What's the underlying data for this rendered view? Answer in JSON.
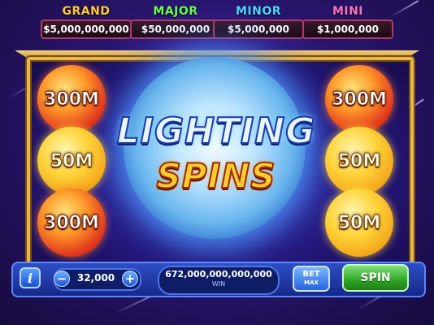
{
  "jackpots": [
    {
      "label": "GRAND",
      "value": "$5,000,000,000",
      "color": "#ffcc33"
    },
    {
      "label": "MAJOR",
      "value": "$50,000,000",
      "color": "#6bff4a"
    },
    {
      "label": "MINOR",
      "value": "$5,000,000",
      "color": "#4ad8ff"
    },
    {
      "label": "MINI",
      "value": "$1,000,000",
      "color": "#ff6ec8"
    }
  ],
  "title": {
    "line1": "LIGHTING",
    "line2": "SPINS"
  },
  "orbs": {
    "left": [
      "300M",
      "50M",
      "300M"
    ],
    "right": [
      "300M",
      "50M",
      "50M"
    ]
  },
  "controls": {
    "info_label": "i",
    "minus_label": "−",
    "plus_label": "+",
    "bet_value": "32,000",
    "win_amount": "672,000,000,000,000",
    "win_label": "WIN",
    "bet_max_top": "BET",
    "bet_max_bottom": "MAX",
    "spin_label": "SPIN"
  }
}
